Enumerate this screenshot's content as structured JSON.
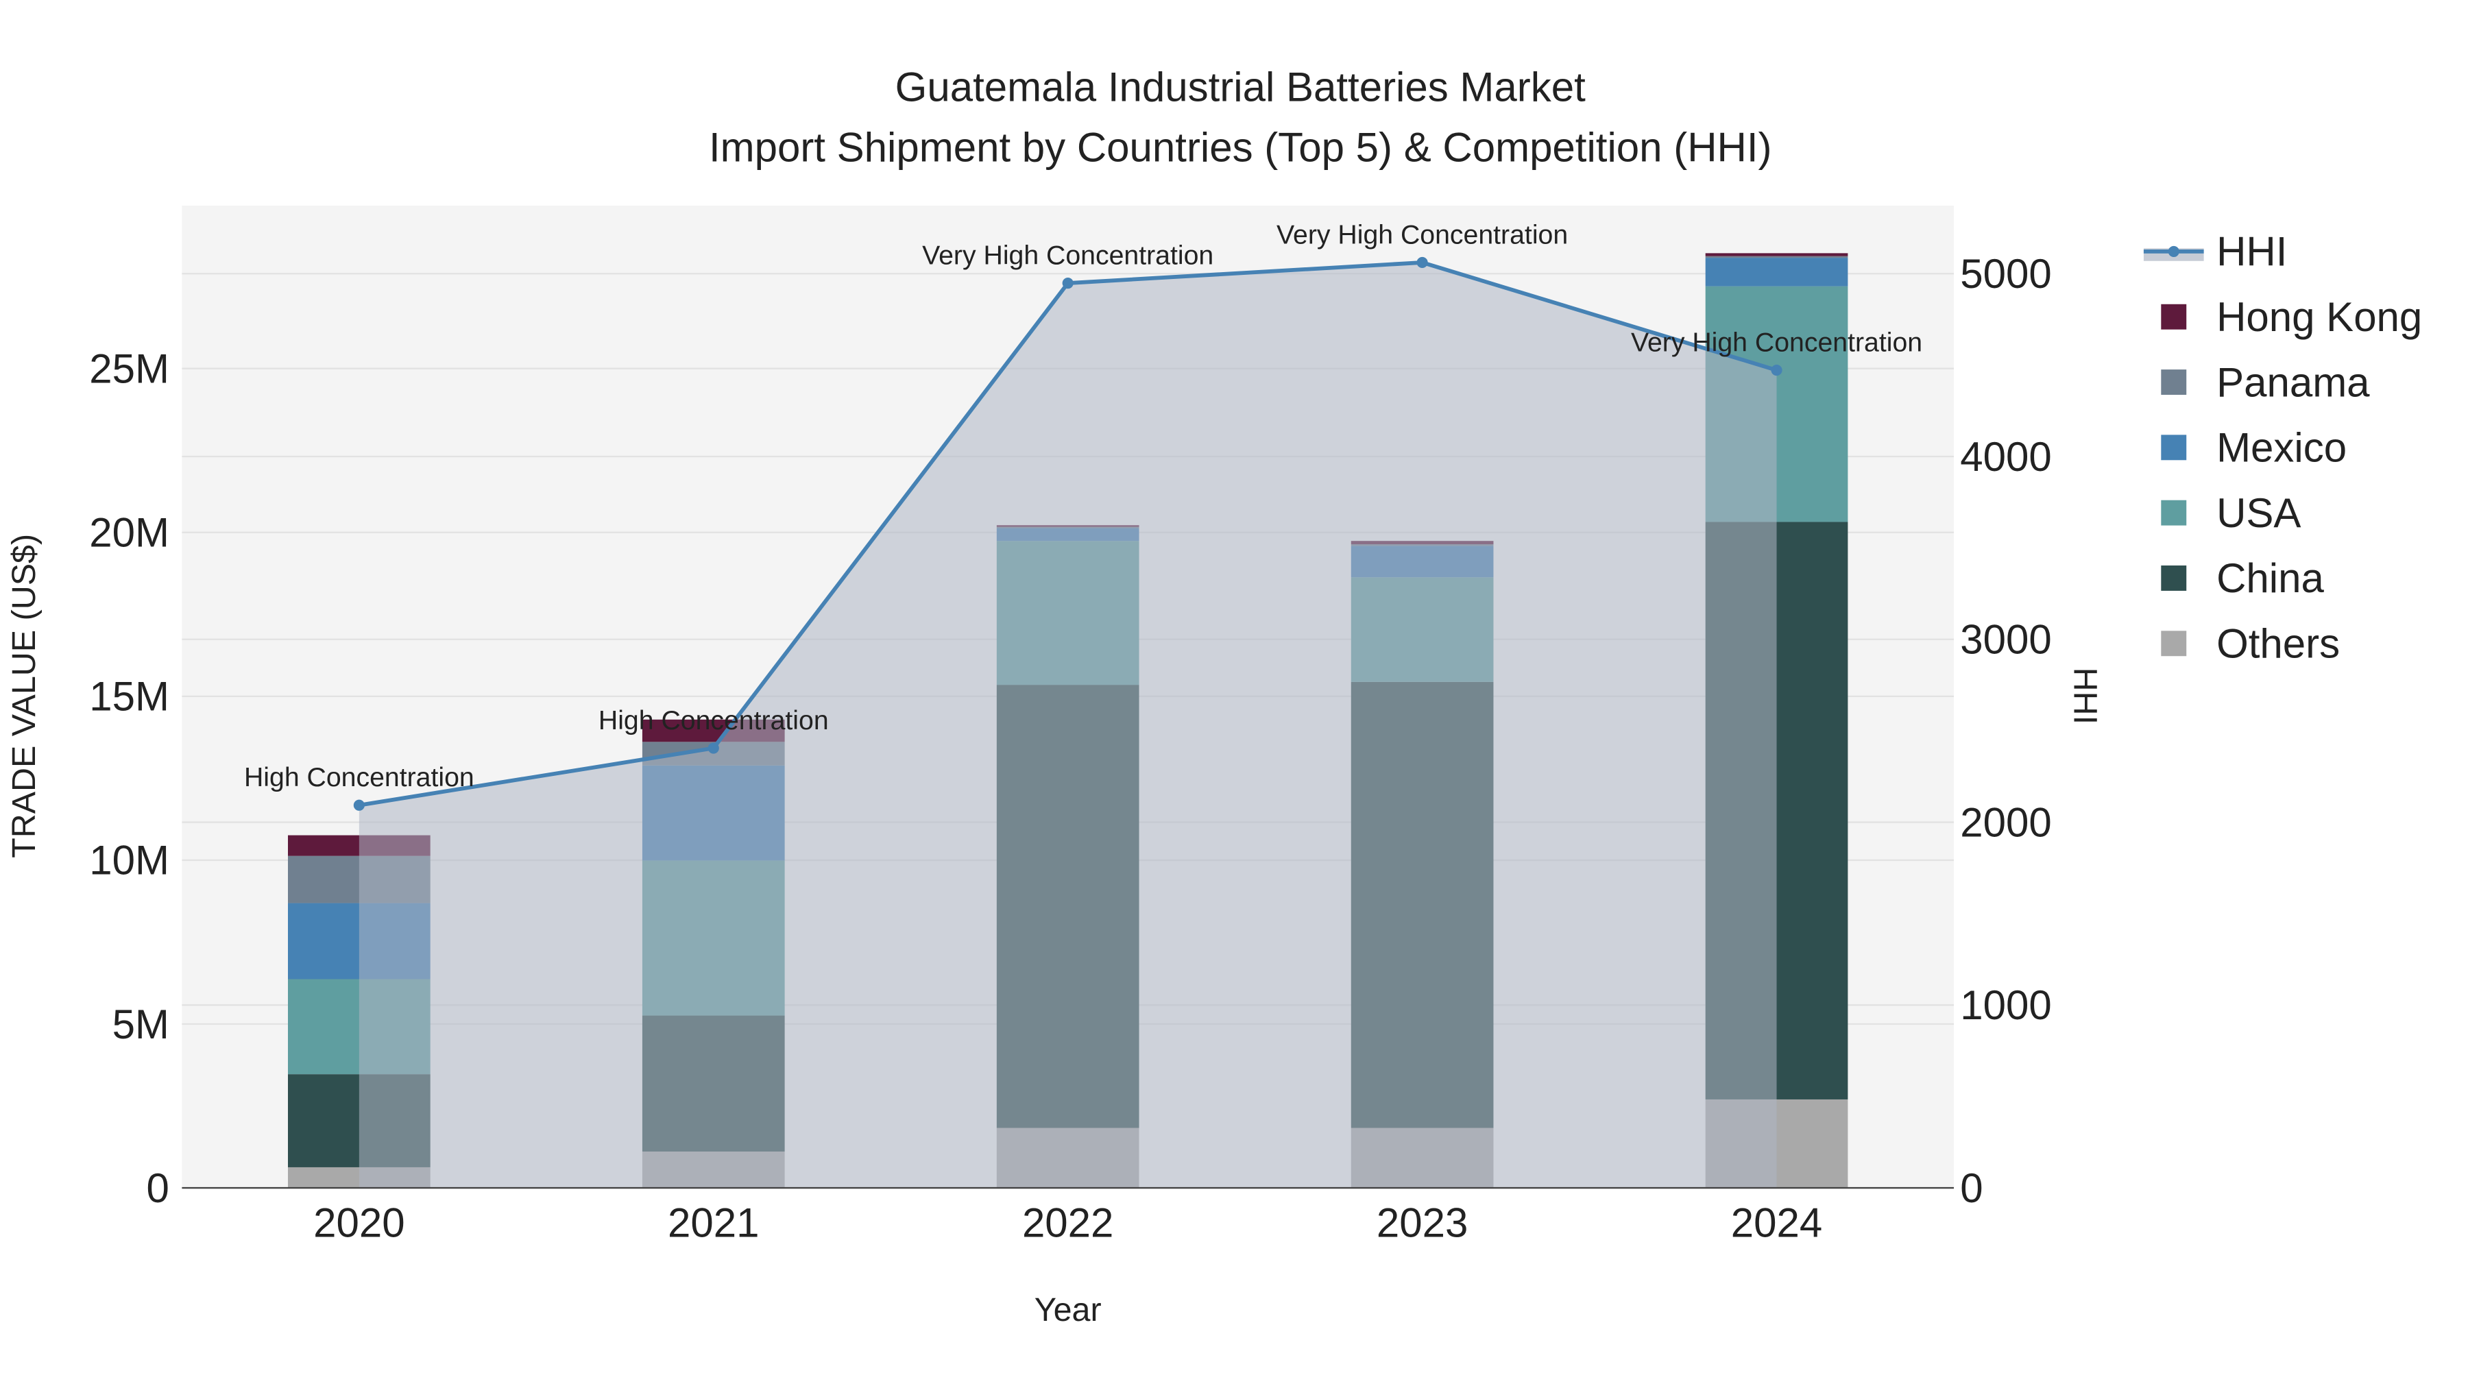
{
  "chart_data": {
    "type": "bar",
    "title": "Guatemala Industrial Batteries Market",
    "subtitle": "Import Shipment by Countries (Top 5) & Competition (HHI)",
    "xlabel": "Year",
    "ylabel": "TRADE VALUE (US$)",
    "y2label": "HHI",
    "categories": [
      "2020",
      "2021",
      "2022",
      "2023",
      "2024"
    ],
    "ylim": [
      0,
      30000000
    ],
    "y2lim": [
      0,
      5380
    ],
    "yticks": [
      0,
      5000000,
      10000000,
      15000000,
      20000000,
      25000000
    ],
    "ytick_labels": [
      "0",
      "5M",
      "10M",
      "15M",
      "20M",
      "25M"
    ],
    "y2ticks": [
      0,
      1000,
      2000,
      3000,
      4000,
      5000
    ],
    "y2tick_labels": [
      "0",
      "1000",
      "2000",
      "3000",
      "4000",
      "5000"
    ],
    "stacked": true,
    "grid": true,
    "legend_position": "right",
    "series": [
      {
        "name": "Others",
        "color": "#a9a9a9",
        "values": [
          630000,
          1110000,
          1830000,
          1830000,
          2700000
        ]
      },
      {
        "name": "China",
        "color": "#2f4f4f",
        "values": [
          2840000,
          4150000,
          13520000,
          13610000,
          17620000
        ]
      },
      {
        "name": "USA",
        "color": "#5f9ea0",
        "values": [
          2900000,
          4730000,
          4390000,
          3190000,
          7190000
        ]
      },
      {
        "name": "Mexico",
        "color": "#4682b4",
        "values": [
          2320000,
          2900000,
          390000,
          960000,
          870000
        ]
      },
      {
        "name": "Panama",
        "color": "#708090",
        "values": [
          1440000,
          720000,
          40000,
          50000,
          50000
        ]
      },
      {
        "name": "Hong Kong",
        "color": "#5e1a3c",
        "values": [
          630000,
          680000,
          50000,
          100000,
          90000
        ]
      }
    ],
    "hhi": {
      "name": "HHI",
      "color": "#4682b4",
      "values": [
        2093,
        2405,
        4948,
        5061,
        4472
      ],
      "annotations": [
        "High Concentration",
        "High Concentration",
        "Very High Concentration",
        "Very High Concentration",
        "Very High Concentration"
      ]
    },
    "legend_order": [
      "HHI",
      "Hong Kong",
      "Panama",
      "Mexico",
      "USA",
      "China",
      "Others"
    ]
  }
}
